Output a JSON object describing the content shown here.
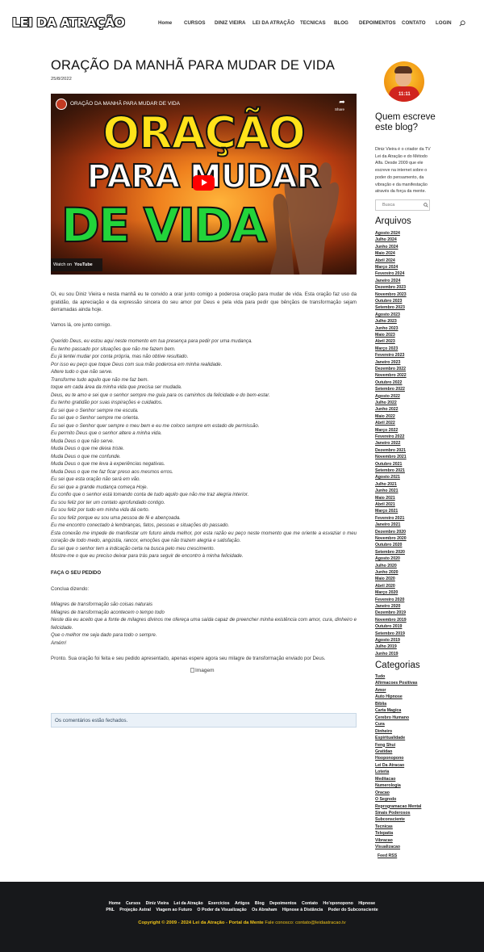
{
  "header": {
    "logo": "LEI DA ATRAÇÃO",
    "nav": [
      "Home",
      "CURSOS",
      "DINIZ VIEIRA",
      "LEI DA ATRAÇÃO",
      "TECNICAS",
      "BLOG",
      "DEPOIMENTOS",
      "CONTATO",
      "LOGIN"
    ]
  },
  "post": {
    "title": "ORAÇÃO DA MANHÃ PARA MUDAR DE VIDA",
    "date": "25/8/2022",
    "video": {
      "channel_title": "ORAÇÃO DA MANHÃ PARA MUDAR DE VIDA",
      "share": "Share",
      "thumb_line1": "ORAÇÃO",
      "thumb_line2": "PARA MUDAR",
      "thumb_line3": "DE VIDA",
      "watch_on": "Watch on",
      "youtube": "YouTube"
    },
    "intro": "Oi, eu sou Diniz Vieira e nesta manhã eu te convido a orar junto comigo a poderosa oração para mudar de vida. Esta oração faz uso da gratidão, da apreciação e da expressão sincera do seu amor por Deus e pela vida para pedir que bênçãos de transformação sejam derramadas ainda hoje.",
    "lets_pray": "Vamos lá, ore junto comigo.",
    "prayer": [
      "Querido Deus, eu estou aqui neste momento em tua presença para pedir por uma mudança.",
      "Eu tenho passado por situações que não me fazem bem.",
      "Eu já tentei mudar por conta própria, mas não obtive resultado.",
      "Por isso eu peço que toque Deus com sua mão poderosa em minha realidade.",
      "Altere tudo o que não serve.",
      "Transforme tudo aquilo que não me faz bem.",
      "toque em cada área da minha vida que precisa ser mudada.",
      "Deus, eu te amo e sei que o senhor sempre me guia para os caminhos da felicidade e do bem-estar.",
      "Eu tenho gratidão por suas inspirações e cuidados.",
      "Eu sei que o Senhor sempre me escuta.",
      "Eu sei que o Senhor sempre me orienta.",
      "Eu sei que o Senhor quer sempre o meu bem e eu me coloco sempre em estado de permissão.",
      "Eu permito Deus que o senhor altere a minha vida.",
      "Muda Deus o que não serve.",
      "Muda Deus o que me deixa triste.",
      "Muda Deus o que me confunde.",
      "Muda Deus o que me leva à experiências negativas.",
      "Muda Deus o que me faz ficar preso aos mesmos erros.",
      "Eu sei que esta oração não será em vão.",
      "Eu sei que a grande mudança começa Hoje.",
      "Eu confio que o senhor está tomando conta de tudo aquilo que não me traz alegria interior.",
      "Eu sou feliz por ter um contato aprofundado contigo.",
      "Eu sou feliz por tudo em minha vida dá certo.",
      "Eu sou feliz porque eu sou uma pessoa de fé e abençoada.",
      "Eu me encontro conectado à lembranças, fatos, pessoas e situações do passado.",
      "Esta conexão me impede de manifestar um futuro ainda melhor, por esta razão eu peço neste momento que me oriente a esvaziar o meu coração de todo medo, angústia, rancor, emoções que não trazem alegria e satisfação.",
      "Eu sei que o senhor tem a indicação certa na busca pelo meu crescimento.",
      "Mostre-me o que eu preciso deixar para trás para seguir de encontro à minha felicidade."
    ],
    "request_heading": "FAÇA O SEU PEDIDO",
    "conclude": "Conclua dizendo:",
    "closing": [
      "Milagres de transformação são coisas naturais",
      "Milagres de transformação acontecem o tempo todo",
      "Neste dia eu aceito que a fonte de milagres divinos me ofereça uma saída capaz de preencher minha existência com amor, cura, dinheiro e felicidade.",
      "Que o melhor me seja dado para todo o sempre.",
      "Amém!"
    ],
    "done": "Pronto. Sua oração foi feita e seu pedido apresentado, apenas espere agora seu milagre de transformação enviado por Deus.",
    "image_alt": "Imagem",
    "comments_closed": "Os comentários estão fechados."
  },
  "sidebar": {
    "author_badge": "11:11",
    "about_title": "Quem escreve este blog?",
    "about_text": "Diniz Vieira é o criador da TV Lei da Atração e do Método Alfa. Desde 2009 que ele escreve na internet sobre o poder do pensamento, da vibração e da manifestação através da força da mente.",
    "search_placeholder": "Busca",
    "archives_title": "Arquivos",
    "archives": [
      "Agosto 2024",
      "Julho 2024",
      "Junho 2024",
      "Maio 2024",
      "Abril 2024",
      "Março 2024",
      "Fevereiro 2024",
      "Janeiro 2024",
      "Dezembro 2023",
      "Novembro 2023",
      "Outubro 2023",
      "Setembro 2023",
      "Agosto 2023",
      "Julho 2023",
      "Junho 2023",
      "Maio 2023",
      "Abril 2023",
      "Março 2023",
      "Fevereiro 2023",
      "Janeiro 2023",
      "Dezembro 2022",
      "Novembro 2022",
      "Outubro 2022",
      "Setembro 2022",
      "Agosto 2022",
      "Julho 2022",
      "Junho 2022",
      "Maio 2022",
      "Abril 2022",
      "Março 2022",
      "Fevereiro 2022",
      "Janeiro 2022",
      "Dezembro 2021",
      "Novembro 2021",
      "Outubro 2021",
      "Setembro 2021",
      "Agosto 2021",
      "Julho 2021",
      "Junho 2021",
      "Maio 2021",
      "Abril 2021",
      "Março 2021",
      "Fevereiro 2021",
      "Janeiro 2021",
      "Dezembro 2020",
      "Novembro 2020",
      "Outubro 2020",
      "Setembro 2020",
      "Agosto 2020",
      "Julho 2020",
      "Junho 2020",
      "Maio 2020",
      "Abril 2020",
      "Março 2020",
      "Fevereiro 2020",
      "Janeiro 2020",
      "Dezembro 2019",
      "Novembro 2019",
      "Outubro 2019",
      "Setembro 2019",
      "Agosto 2019",
      "Julho 2019",
      "Junho 2019"
    ],
    "categories_title": "Categorias",
    "categories": [
      "Tudo",
      "Afirmacoes Positivas",
      "Amor",
      "Auto Hipnose",
      "Bíblia",
      "Carta Magica",
      "Cerebro Humano",
      "Cura",
      "Dinheiro",
      "Espiritualidade",
      "Feng Shui",
      "Gratidao",
      "Hooponopono",
      "Lei Da Atracao",
      "Loteria",
      "Meditacao",
      "Numerologia",
      "Oracao",
      "O Segredo",
      "Reprogramacao Mental",
      "Sinais Poderosos",
      "Subconsciente",
      "Tecnicas",
      "Telepatia",
      "Vibracao",
      "Visualizacao"
    ],
    "feed": "Feed RSS"
  },
  "footer": {
    "row1": [
      "Home",
      "Cursos",
      "Diniz Vieira",
      "Lei da Atração",
      "Exercícios",
      "Artigos",
      "Blog",
      "Depoimentos",
      "Contato",
      "Ho'oponopono",
      "Hipnose"
    ],
    "row2": [
      "PNL",
      "Projeção Astral",
      "Viagem ao Futuro",
      "O Poder da Visualização",
      "Os Abraham",
      "Hipnose à Distância",
      "Poder do Subconsciente"
    ],
    "copyright": "Copyright © 2009 - 2024 Lei da Atração - Portal da Mente",
    "contact": "Fale conosco: contato@leidaatracao.tv"
  }
}
